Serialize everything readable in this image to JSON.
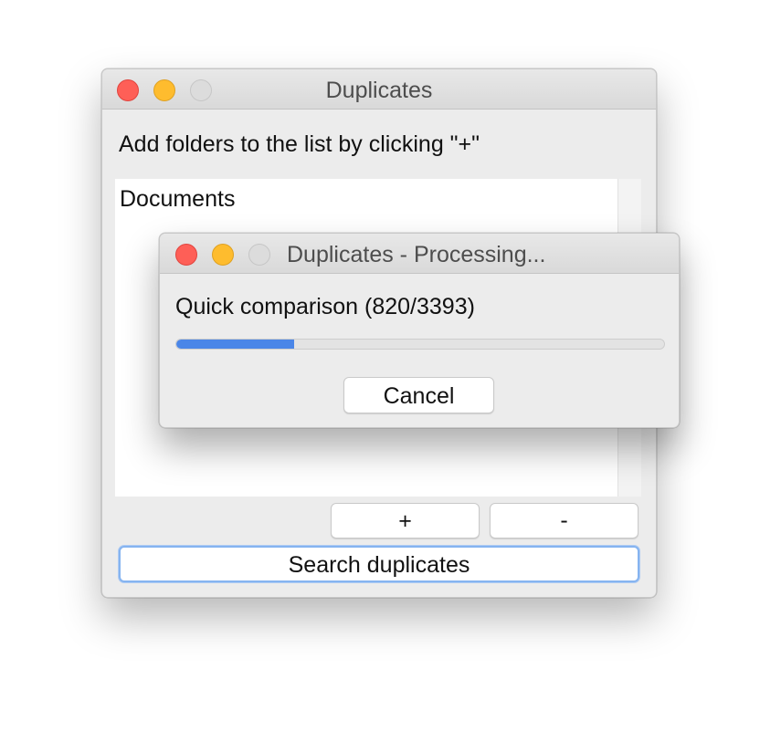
{
  "main_window": {
    "title": "Duplicates",
    "instruction": "Add folders to the list by clicking \"+\"",
    "folders": [
      "Documents"
    ],
    "add_label": "+",
    "remove_label": "-",
    "search_label": "Search duplicates"
  },
  "progress_dialog": {
    "title": "Duplicates - Processing...",
    "status": "Quick comparison (820/3393)",
    "progress": {
      "current": 820,
      "total": 3393
    },
    "cancel_label": "Cancel"
  },
  "colors": {
    "close": "#fe5f57",
    "minimize": "#febc2e",
    "zoom_disabled": "#dcdcdc",
    "progress_accent": "#4a86e8",
    "focus_ring": "#86b4f0"
  },
  "icons": {
    "close": "close-icon",
    "minimize": "minimize-icon",
    "zoom": "zoom-icon"
  }
}
